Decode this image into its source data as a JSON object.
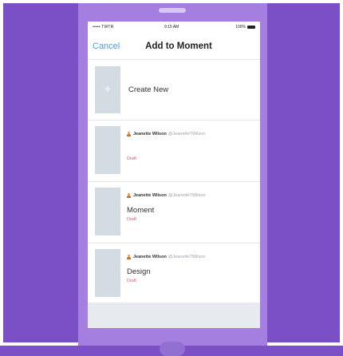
{
  "status_bar": {
    "carrier": "••••• TWTR",
    "time": "9:15 AM",
    "battery": "100%"
  },
  "nav": {
    "cancel_label": "Cancel",
    "title": "Add to Moment"
  },
  "create_new": {
    "plus": "+",
    "label": "Create New"
  },
  "moments": [
    {
      "author": "Jeanette Wilson",
      "handle": "@JeanetteTWilson",
      "title": "",
      "status": "Draft"
    },
    {
      "author": "Jeanette Wilson",
      "handle": "@JeanetteTWilson",
      "title": "Moment",
      "status": "Draft"
    },
    {
      "author": "Jeanette Wilson",
      "handle": "@JeanetteTWilson",
      "title": "Design",
      "status": "Draft"
    }
  ],
  "colors": {
    "background": "#7b4fc6",
    "phone": "#a57fe0",
    "link": "#4a9fe2",
    "draft": "#e5566a",
    "thumbnail": "#d3dbe3"
  }
}
